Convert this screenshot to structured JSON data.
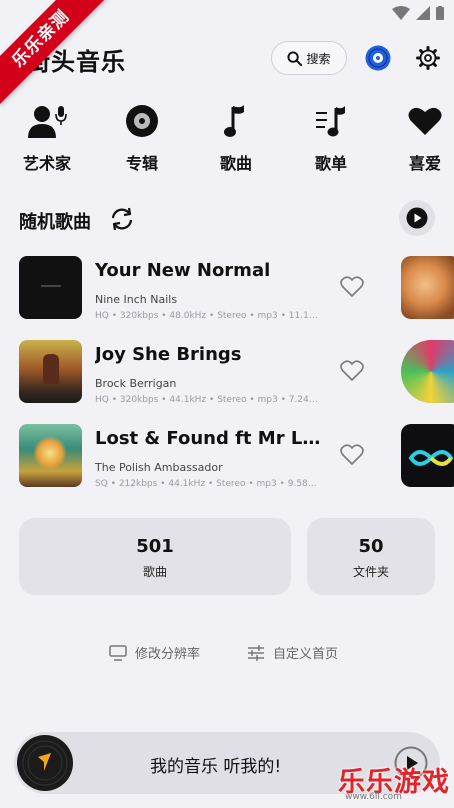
{
  "watermark": {
    "ribbon": "乐乐亲测",
    "brand": "乐乐游戏",
    "url": "www.6ll.com"
  },
  "header": {
    "title": "街头音乐",
    "search_label": "搜索"
  },
  "categories": [
    {
      "label": "艺术家",
      "icon": "artist-icon"
    },
    {
      "label": "专辑",
      "icon": "album-icon"
    },
    {
      "label": "歌曲",
      "icon": "music-note-icon"
    },
    {
      "label": "歌单",
      "icon": "playlist-icon"
    },
    {
      "label": "喜爱",
      "icon": "heart-icon"
    }
  ],
  "section": {
    "title": "随机歌曲"
  },
  "songs": [
    {
      "title": "Your New Normal",
      "artist": "Nine Inch Nails",
      "meta": "HQ • 320kbps • 48.0kHz • Stereo • mp3 • 11.16..."
    },
    {
      "title": "Joy She Brings",
      "artist": "Brock Berrigan",
      "meta": "HQ • 320kbps • 44.1kHz • Stereo • mp3 • 7.24M..."
    },
    {
      "title": "Lost & Found ft Mr Lif &...",
      "artist": "The Polish Ambassador",
      "meta": "SQ • 212kbps • 44.1kHz • Stereo • mp3 • 9.58M..."
    }
  ],
  "stats": [
    {
      "value": "501",
      "label": "歌曲"
    },
    {
      "value": "50",
      "label": "文件夹"
    }
  ],
  "footer": {
    "resolution": "修改分辨率",
    "customize": "自定义首页"
  },
  "player": {
    "text": "我的音乐 听我的!"
  },
  "colors": {
    "accent": "#1f5fe0",
    "background": "#f2f1f6",
    "ribbon": "#d3001a"
  }
}
